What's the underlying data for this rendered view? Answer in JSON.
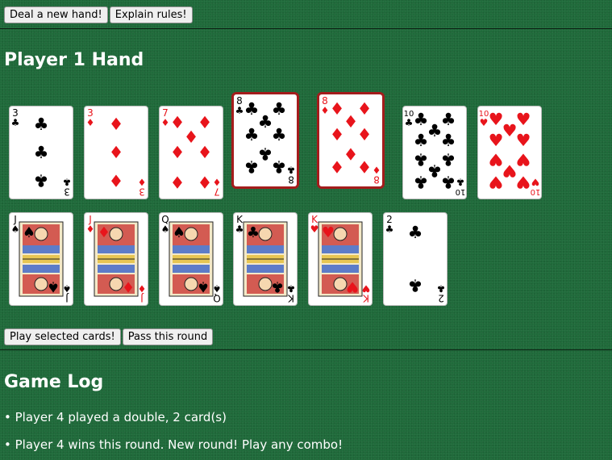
{
  "toolbar": {
    "deal_label": "Deal a new hand!",
    "rules_label": "Explain rules!"
  },
  "hand": {
    "title": "Player 1 Hand",
    "cards": [
      {
        "rank": "3",
        "suit": "clubs",
        "selected": false
      },
      {
        "rank": "3",
        "suit": "diamonds",
        "selected": false
      },
      {
        "rank": "7",
        "suit": "diamonds",
        "selected": false
      },
      {
        "rank": "8",
        "suit": "clubs",
        "selected": true
      },
      {
        "rank": "8",
        "suit": "diamonds",
        "selected": true
      },
      {
        "rank": "10",
        "suit": "clubs",
        "selected": false
      },
      {
        "rank": "10",
        "suit": "hearts",
        "selected": false
      },
      {
        "rank": "J",
        "suit": "spades",
        "selected": false
      },
      {
        "rank": "J",
        "suit": "diamonds",
        "selected": false
      },
      {
        "rank": "Q",
        "suit": "spades",
        "selected": false
      },
      {
        "rank": "K",
        "suit": "clubs",
        "selected": false
      },
      {
        "rank": "K",
        "suit": "hearts",
        "selected": false
      },
      {
        "rank": "2",
        "suit": "clubs",
        "selected": false
      }
    ]
  },
  "actions": {
    "play_label": "Play selected cards!",
    "pass_label": "Pass this round"
  },
  "log": {
    "title": "Game Log",
    "entries": [
      "• Player 4 played a double, 2 card(s)",
      "• Player 4 wins this round. New round! Play any combo!"
    ]
  },
  "colors": {
    "table_green": "#1f6a3a",
    "red_suit": "#e8141b",
    "black_suit": "#000000",
    "selected_border": "#a41c1c"
  }
}
